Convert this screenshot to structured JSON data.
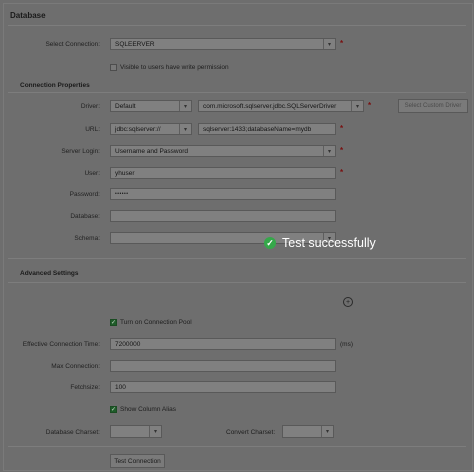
{
  "sections": {
    "database": "Database",
    "connection_properties": "Connection Properties",
    "advanced_settings": "Advanced Settings"
  },
  "select_connection": {
    "label": "Select Connection:",
    "value": "SQLEERVER"
  },
  "visible_to_users": {
    "label": "Visible to users have write permission",
    "checked": false
  },
  "driver": {
    "label": "Driver:",
    "value": "Default",
    "class_value": "com.microsoft.sqlserver.jdbc.SQLServerDriver",
    "button": "Select Custom Driver"
  },
  "url": {
    "label": "URL:",
    "prefix": "jdbc:sqlserver://",
    "value": "sqlserver:1433;databaseName=mydb"
  },
  "server_login": {
    "label": "Server Login:",
    "value": "Username and Password"
  },
  "user": {
    "label": "User:",
    "value": "yhuser"
  },
  "password": {
    "label": "Password:",
    "value": "••••••"
  },
  "database": {
    "label": "Database:",
    "value": ""
  },
  "schema": {
    "label": "Schema:",
    "value": ""
  },
  "toast": {
    "text": "Test successfully",
    "color": "#35a84a"
  },
  "advanced": {
    "connection_pool": {
      "label": "Turn on Connection Pool",
      "checked": true
    },
    "effective_time": {
      "label": "Effective Connection Time:",
      "value": "7200000",
      "unit": "(ms)"
    },
    "max_connection": {
      "label": "Max Connection:",
      "value": ""
    },
    "fetchsize": {
      "label": "Fetchsize:",
      "value": "100"
    },
    "show_column_alias": {
      "label": "Show Column Alias",
      "checked": true
    },
    "db_charset": {
      "label": "Database Charset:",
      "value": ""
    },
    "convert_charset": {
      "label": "Convert Charset:",
      "value": ""
    }
  },
  "required_mark": "*",
  "test_button": "Test Connection",
  "icons": {
    "dropdown": "▾",
    "check": "✓",
    "plus": "+"
  }
}
